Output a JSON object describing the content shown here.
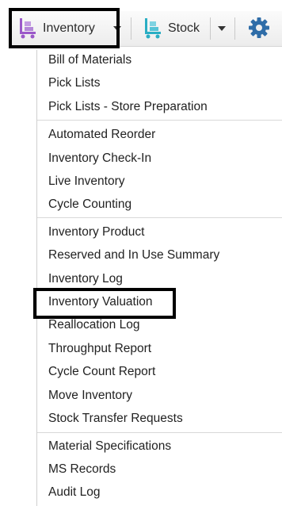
{
  "toolbar": {
    "inventory_label": "Inventory",
    "stock_label": "Stock",
    "icons": {
      "inventory": "cart-icon",
      "stock": "cart-icon",
      "settings": "gear-icon",
      "dropdown": "chevron-down-icon"
    },
    "colors": {
      "inventory_icon": "#9b59c9",
      "stock_icon": "#2aaec4",
      "gear_icon": "#2f6da8"
    }
  },
  "menu": {
    "group1": [
      "Bill of Materials",
      "Pick Lists",
      "Pick Lists - Store Preparation"
    ],
    "group2": [
      "Automated Reorder",
      "Inventory Check-In",
      "Live Inventory",
      "Cycle Counting"
    ],
    "group3": [
      "Inventory Product",
      "Reserved and In Use Summary",
      "Inventory Log",
      "Inventory Valuation",
      "Reallocation Log",
      "Throughput Report",
      "Cycle Count Report",
      "Move Inventory",
      "Stock Transfer Requests"
    ],
    "group4": [
      "Material Specifications",
      "MS Records",
      "Audit Log"
    ]
  },
  "highlights": [
    "Inventory",
    "Inventory Valuation"
  ]
}
